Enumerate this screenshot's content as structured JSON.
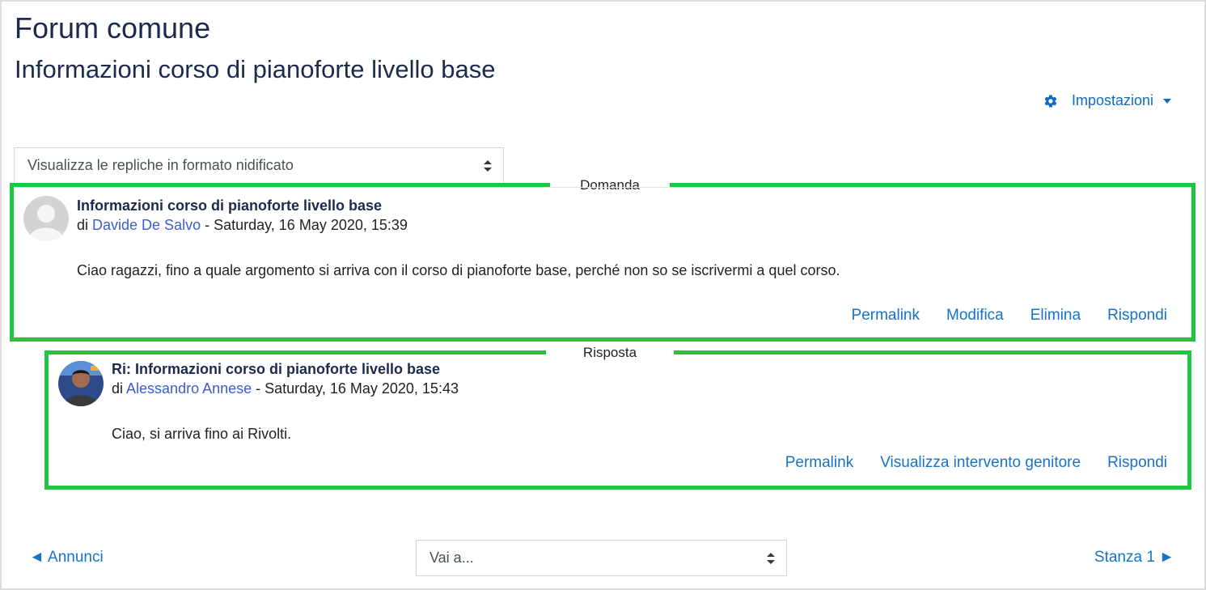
{
  "page": {
    "forum_title": "Forum comune",
    "discussion_title": "Informazioni corso di pianoforte livello base",
    "settings_label": "Impostazioni"
  },
  "display_mode": {
    "selected": "Visualizza le repliche in formato nidificato"
  },
  "annotations": {
    "question_label": "Domanda",
    "answer_label": "Risposta",
    "highlight_color": "#1ec73f"
  },
  "posts": [
    {
      "subject": "Informazioni corso di pianoforte livello base",
      "by_prefix": "di ",
      "author": "Davide De Salvo",
      "date": " - Saturday, 16 May 2020, 15:39",
      "body": "Ciao ragazzi, fino a quale argomento si arriva con il corso di pianoforte base, perché non so se iscrivermi a quel corso.",
      "actions": [
        "Permalink",
        "Modifica",
        "Elimina",
        "Rispondi"
      ]
    },
    {
      "subject": "Ri: Informazioni corso di pianoforte livello base",
      "by_prefix": "di ",
      "author": "Alessandro Annese",
      "date": " - Saturday, 16 May 2020, 15:43",
      "body": "Ciao, si arriva fino ai Rivolti.",
      "actions": [
        "Permalink",
        "Visualizza intervento genitore",
        "Rispondi"
      ]
    }
  ],
  "navigation": {
    "prev_label": "◄ Annunci",
    "jump_placeholder": "Vai a...",
    "next_label": "Stanza 1 ►"
  },
  "colors": {
    "link": "#1773c5",
    "author_link": "#3c5bd6",
    "title": "#1d2a4d"
  }
}
